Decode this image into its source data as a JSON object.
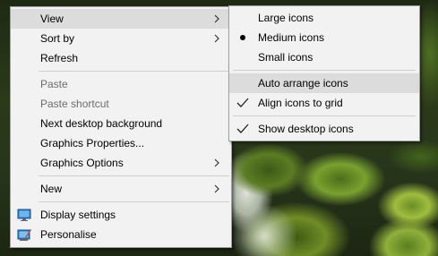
{
  "context_menu": {
    "items": [
      {
        "label": "View"
      },
      {
        "label": "Sort by"
      },
      {
        "label": "Refresh"
      },
      {
        "label": "Paste"
      },
      {
        "label": "Paste shortcut"
      },
      {
        "label": "Next desktop background"
      },
      {
        "label": "Graphics Properties..."
      },
      {
        "label": "Graphics Options"
      },
      {
        "label": "New"
      },
      {
        "label": "Display settings",
        "icon": "display-settings-icon"
      },
      {
        "label": "Personalise",
        "icon": "personalise-icon"
      }
    ]
  },
  "view_submenu": {
    "items": [
      {
        "label": "Large icons"
      },
      {
        "label": "Medium icons",
        "selected": true
      },
      {
        "label": "Small icons"
      },
      {
        "label": "Auto arrange icons",
        "highlighted": true
      },
      {
        "label": "Align icons to grid",
        "checked": true
      },
      {
        "label": "Show desktop icons",
        "checked": true
      }
    ]
  },
  "colors": {
    "menu_background": "#f2f2f2",
    "hover_background": "#dcdcdc",
    "disabled_text": "#6d6d6d",
    "accent": "#1e73c8"
  }
}
